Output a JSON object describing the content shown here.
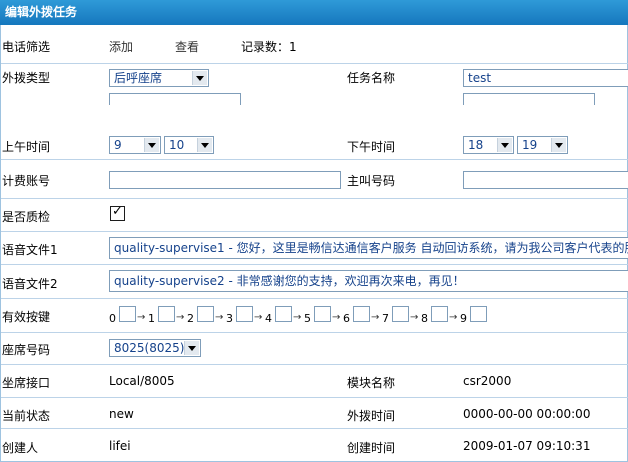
{
  "title": "编辑外拨任务",
  "phone_filter": {
    "label": "电话筛选",
    "add": "添加",
    "view": "查看",
    "record_count": "记录数：1"
  },
  "outbound_type": {
    "label": "外拨类型",
    "value": "后呼座席"
  },
  "task_name": {
    "label": "任务名称",
    "value": "test"
  },
  "morning_time": {
    "label": "上午时间",
    "start": "9",
    "end": "10"
  },
  "afternoon_time": {
    "label": "下午时间",
    "start": "18",
    "end": "19"
  },
  "billing_account": {
    "label": "计费账号",
    "value": ""
  },
  "caller_number": {
    "label": "主叫号码",
    "value": ""
  },
  "quality_check": {
    "label": "是否质检",
    "checked": true
  },
  "voice_file_1": {
    "label": "语音文件1",
    "value": "quality-supervise1 - 您好，这里是畅信达通信客户服务 自动回访系统，请为我公司客户代表的服务"
  },
  "voice_file_2": {
    "label": "语音文件2",
    "value": "quality-supervise2 - 非常感谢您的支持，欢迎再次来电，再见！"
  },
  "valid_keys": {
    "label": "有效按键",
    "keys": [
      "0",
      "1",
      "2",
      "3",
      "4",
      "5",
      "6",
      "7",
      "8",
      "9"
    ],
    "arrow": "→"
  },
  "seat_number": {
    "label": "座席号码",
    "value": "8025(8025)"
  },
  "seat_interface": {
    "label": "坐席接口",
    "value": "Local/8005"
  },
  "module_name": {
    "label": "模块名称",
    "value": "csr2000"
  },
  "current_status": {
    "label": "当前状态",
    "value": "new"
  },
  "outbound_time": {
    "label": "外拨时间",
    "value": "0000-00-00 00:00:00"
  },
  "creator": {
    "label": "创建人",
    "value": "lifei"
  },
  "create_time": {
    "label": "创建时间",
    "value": "2009-01-07 09:10:31"
  },
  "colors": {
    "titlebar": "#1a80c4",
    "border": "#bcd3e8",
    "field_text": "#15428b"
  }
}
